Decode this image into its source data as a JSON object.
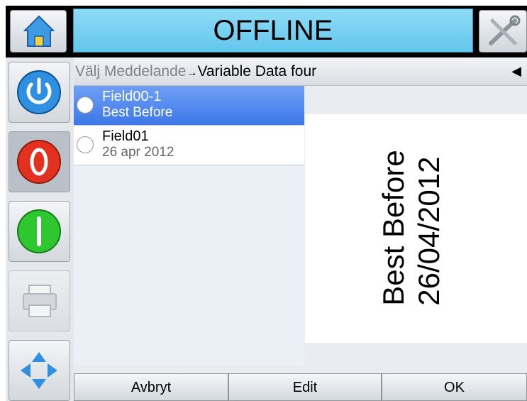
{
  "header": {
    "status_text": "OFFLINE",
    "home_icon": "home-icon",
    "tools_icon": "tools-icon"
  },
  "sidebar": {
    "buttons": [
      "power-icon",
      "stop-icon",
      "start-icon",
      "printer-icon",
      "navigation-arrows-icon"
    ]
  },
  "breadcrumb": {
    "parent": "Välj Meddelande",
    "separator": "→",
    "current": "Variable Data four",
    "back_glyph": "◀"
  },
  "fields": [
    {
      "name": "Field00-1",
      "value": "Best Before",
      "selected": true
    },
    {
      "name": "Field01",
      "value": "26 apr 2012",
      "selected": false
    }
  ],
  "preview": {
    "line1": "Best Before",
    "line2": "26/04/2012"
  },
  "footer": {
    "cancel_label": "Avbryt",
    "edit_label": "Edit",
    "ok_label": "OK"
  },
  "colors": {
    "status_bg": "#6fcdf0",
    "selected_row": "#4a82ec",
    "power_button": "#2f8fe0",
    "stop_button": "#e2321f",
    "start_button": "#2fc72f"
  }
}
